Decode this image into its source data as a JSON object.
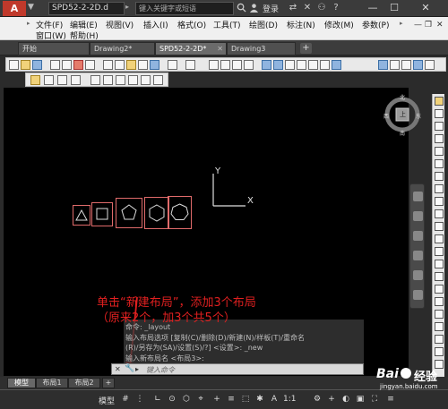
{
  "titlebar": {
    "app_logo": "A",
    "doc_title": "SPD52-2-2D.d",
    "search_placeholder": "键入关键字或短语",
    "login": "登录"
  },
  "menubar": {
    "items_row1": [
      "文件(F)",
      "编辑(E)",
      "视图(V)",
      "插入(I)",
      "格式(O)",
      "工具(T)",
      "绘图(D)",
      "标注(N)",
      "修改(M)",
      "参数(P)"
    ],
    "items_row2": [
      "窗口(W)",
      "帮助(H)"
    ]
  },
  "tabs": {
    "items": [
      {
        "label": "开始"
      },
      {
        "label": "Drawing2*"
      },
      {
        "label": "SPD52-2-2D*"
      },
      {
        "label": "Drawing3"
      }
    ],
    "new_tab": "+"
  },
  "viewcube": {
    "north": "北",
    "south": "南",
    "east": "东",
    "west": "西",
    "face": "上"
  },
  "ucs": {
    "x": "X",
    "y": "Y"
  },
  "command": {
    "history": [
      "命令: _layout",
      "输入布局选项 [复制(C)/删除(D)/新建(N)/样板(T)/重命名",
      "(R)/另存为(SA)/设置(S)/?] <设置>: _new",
      "输入新布局名 <布局3>:"
    ],
    "placeholder": "键入命令"
  },
  "annotation": {
    "line1": "单击“新建布局”，添加3个布局",
    "line2": "（原来2个，加3个共5个）"
  },
  "layout_tabs": {
    "items": [
      {
        "label": "模型"
      },
      {
        "label": "布局1"
      },
      {
        "label": "布局2"
      }
    ],
    "add": "+"
  },
  "statusbar": {
    "model": "模型",
    "scale": "1:1"
  },
  "watermark": {
    "brand": "Bai",
    "brand2": "经验",
    "url": "jingyan.baidu.com"
  }
}
